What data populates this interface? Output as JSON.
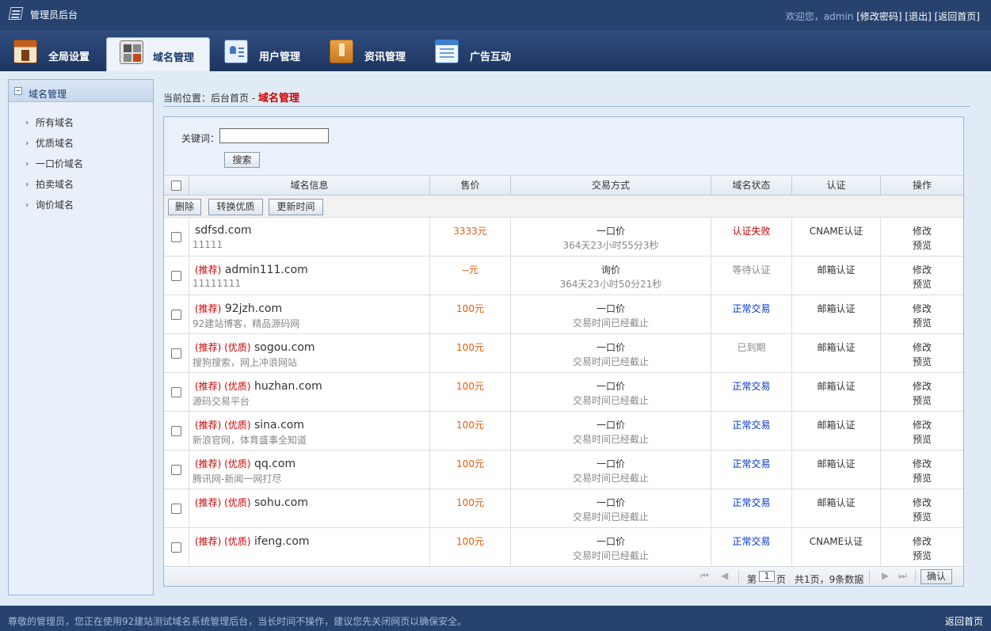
{
  "header": {
    "title": "管理员后台",
    "welcome": "欢迎您，admin",
    "links": [
      "[修改密码]",
      "[退出]",
      "[返回首页]"
    ]
  },
  "nav": {
    "tabs": [
      {
        "label": "全局设置",
        "icon": "global-settings-icon"
      },
      {
        "label": "域名管理",
        "icon": "domain-manage-icon",
        "active": true
      },
      {
        "label": "用户管理",
        "icon": "user-manage-icon"
      },
      {
        "label": "资讯管理",
        "icon": "news-manage-icon"
      },
      {
        "label": "广告互动",
        "icon": "ad-interact-icon"
      }
    ]
  },
  "sidebar": {
    "title": "域名管理",
    "items": [
      "所有域名",
      "优质域名",
      "一口价域名",
      "拍卖域名",
      "询价域名"
    ]
  },
  "breadcrumb": {
    "prefix": "当前位置：",
    "home": "后台首页",
    "sep": " - ",
    "current": "域名管理"
  },
  "search": {
    "label": "关键词：",
    "value": "",
    "button": "搜索"
  },
  "table": {
    "headers": [
      "",
      "域名信息",
      "售价",
      "交易方式",
      "域名状态",
      "认证",
      "操作"
    ],
    "actions": [
      "删除",
      "转换优质",
      "更新时间"
    ],
    "rows": [
      {
        "tags": "",
        "domain": "sdfsd.com",
        "desc": "11111",
        "price": "3333元",
        "type": "一口价",
        "time": "364天23小时55分3秒",
        "status": "认证失败",
        "status_color": "#cc0000",
        "cert": "CNAME认证",
        "op1": "修改",
        "op2": "预览"
      },
      {
        "tags": "(推荐)",
        "domain": "admin111.com",
        "desc": "11111111",
        "price": "--元",
        "type": "询价",
        "time": "364天23小时50分21秒",
        "status": "等待认证",
        "status_color": "#888888",
        "cert": "邮箱认证",
        "op1": "修改",
        "op2": "预览"
      },
      {
        "tags": "(推荐)",
        "domain": "92jzh.com",
        "desc": "92建站博客，精品源码网",
        "price": "100元",
        "type": "一口价",
        "time": "交易时间已经截止",
        "status": "正常交易",
        "status_color": "#0033cc",
        "cert": "邮箱认证",
        "op1": "修改",
        "op2": "预览"
      },
      {
        "tags": "(推荐) (优质)",
        "domain": "sogou.com",
        "desc": "搜狗搜索，网上冲浪网站",
        "price": "100元",
        "type": "一口价",
        "time": "交易时间已经截止",
        "status": "已到期",
        "status_color": "#888888",
        "cert": "邮箱认证",
        "op1": "修改",
        "op2": "预览"
      },
      {
        "tags": "(推荐) (优质)",
        "domain": "huzhan.com",
        "desc": "源码交易平台",
        "price": "100元",
        "type": "一口价",
        "time": "交易时间已经截止",
        "status": "正常交易",
        "status_color": "#0033cc",
        "cert": "邮箱认证",
        "op1": "修改",
        "op2": "预览"
      },
      {
        "tags": "(推荐) (优质)",
        "domain": "sina.com",
        "desc": "新浪官网，体育盛事全知道",
        "price": "100元",
        "type": "一口价",
        "time": "交易时间已经截止",
        "status": "正常交易",
        "status_color": "#0033cc",
        "cert": "邮箱认证",
        "op1": "修改",
        "op2": "预览"
      },
      {
        "tags": "(推荐) (优质)",
        "domain": "qq.com",
        "desc": "腾讯网-新闻一网打尽",
        "price": "100元",
        "type": "一口价",
        "time": "交易时间已经截止",
        "status": "正常交易",
        "status_color": "#0033cc",
        "cert": "邮箱认证",
        "op1": "修改",
        "op2": "预览"
      },
      {
        "tags": "(推荐) (优质)",
        "domain": "sohu.com",
        "desc": "",
        "price": "100元",
        "type": "一口价",
        "time": "交易时间已经截止",
        "status": "正常交易",
        "status_color": "#0033cc",
        "cert": "邮箱认证",
        "op1": "修改",
        "op2": "预览"
      },
      {
        "tags": "(推荐) (优质)",
        "domain": "ifeng.com",
        "desc": "",
        "price": "100元",
        "type": "一口价",
        "time": "交易时间已经截止",
        "status": "正常交易",
        "status_color": "#0033cc",
        "cert": "CNAME认证",
        "op1": "修改",
        "op2": "预览"
      }
    ]
  },
  "pager": {
    "page_prefix": "第",
    "page": "1",
    "page_suffix": "页",
    "summary": "共1页，9条数据",
    "confirm": "确认"
  },
  "footer": {
    "note": "尊敬的管理员，您正在使用92建站测试域名系统管理后台，当长时间不操作，建议您先关闭网页以确保安全。",
    "back": "返回首页"
  }
}
